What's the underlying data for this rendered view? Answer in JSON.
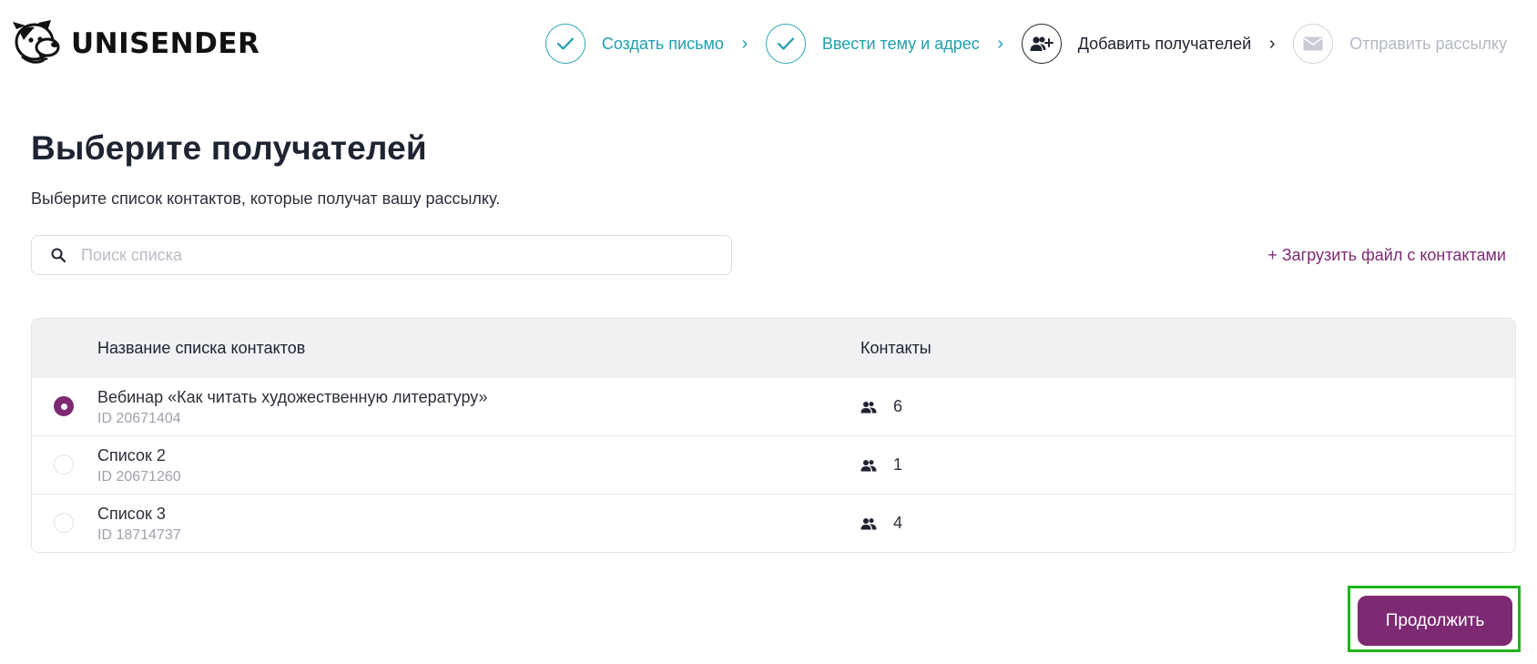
{
  "brand": {
    "name": "UNISENDER"
  },
  "steps": [
    {
      "label": "Создать письмо",
      "state": "done",
      "icon": "check-icon"
    },
    {
      "label": "Ввести тему и адрес",
      "state": "done",
      "icon": "check-icon"
    },
    {
      "label": "Добавить получателей",
      "state": "current",
      "icon": "add-user-icon"
    },
    {
      "label": "Отправить рассылку",
      "state": "pending",
      "icon": "envelope-icon"
    }
  ],
  "page": {
    "title": "Выберите получателей",
    "subtitle": "Выберите список контактов, которые получат вашу рассылку."
  },
  "search": {
    "placeholder": "Поиск списка",
    "value": ""
  },
  "upload_link": "+ Загрузить файл с контактами",
  "table": {
    "columns": {
      "name": "Название списка контактов",
      "contacts": "Контакты"
    },
    "rows": [
      {
        "name": "Вебинар «Как читать художественную литературу»",
        "id": "ID 20671404",
        "contacts": "6",
        "selected": true
      },
      {
        "name": "Список 2",
        "id": "ID 20671260",
        "contacts": "1",
        "selected": false
      },
      {
        "name": "Список 3",
        "id": "ID 18714737",
        "contacts": "4",
        "selected": false
      }
    ]
  },
  "continue_button": "Продолжить",
  "colors": {
    "accent": "#7d2a73",
    "teal": "#1f9fad",
    "highlight": "#21b31e"
  }
}
